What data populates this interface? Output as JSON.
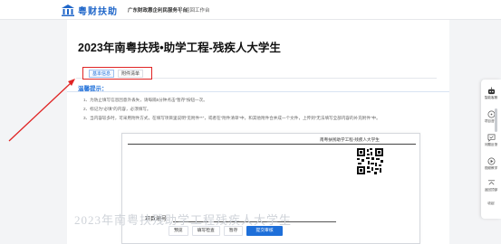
{
  "header": {
    "logo_text": "粤财扶助",
    "platform_name": "广东财政惠企利民服务平台",
    "back_link": "返回工作台"
  },
  "page": {
    "title": "2023年南粤扶残•助学工程-残疾人大学生"
  },
  "tabs": [
    {
      "label": "基本信息",
      "active": true
    },
    {
      "label": "附件清单",
      "active": false
    }
  ],
  "notice": {
    "heading": "温馨提示：",
    "items": [
      "1、为防止填写信息因意外丢失，请每隔5分钟点击“暂存”按钮一次。",
      "2、标记为“必填”的内容，必须填写。",
      "3、当内容较多时，可采用附件方式，在填写项目里说明“见附件**”，或者在“附件清单”中，和其他附件合并成一个文件，上传到“无法填写全部内容的补充附件”中。"
    ]
  },
  "document": {
    "header_text": "南粤扶残助学工程-残疾人大学生",
    "project_label": "项目编号",
    "watermark": "2023年南粤扶残助学工程残疾人大学生"
  },
  "actions": [
    {
      "label": "预览",
      "primary": false
    },
    {
      "label": "填写检查",
      "primary": false
    },
    {
      "label": "暂存",
      "primary": false
    },
    {
      "label": "提交审核",
      "primary": true
    }
  ],
  "sidebar": [
    {
      "label": "智能客服",
      "icon": "robot-icon"
    },
    {
      "label": "项目咨询",
      "icon": "consult-icon"
    },
    {
      "label": "问题反馈",
      "icon": "feedback-icon"
    },
    {
      "label": "视频教学",
      "icon": "video-icon"
    },
    {
      "label": "返回顶部",
      "icon": "back-to-top-icon"
    },
    {
      "label": "收起",
      "icon": "collapse-icon"
    }
  ],
  "colors": {
    "brand": "#1f66c9",
    "primary_button": "#1e6fd9",
    "annotation_red": "#e02424"
  }
}
